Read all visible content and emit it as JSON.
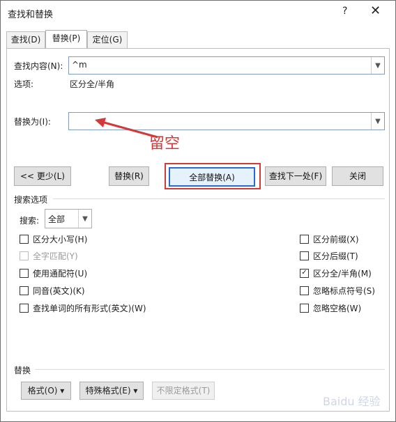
{
  "window": {
    "title": "查找和替换",
    "help": "?",
    "close": "✕"
  },
  "tabs": [
    {
      "label": "查找(D)"
    },
    {
      "label": "替换(P)"
    },
    {
      "label": "定位(G)"
    }
  ],
  "find": {
    "label": "查找内容(N):",
    "value": "^m"
  },
  "options": {
    "label": "选项:",
    "value": "区分全/半角"
  },
  "replace": {
    "label": "替换为(I):",
    "value": ""
  },
  "annotation": {
    "text": "留空"
  },
  "buttons": {
    "less": "<< 更少(L)",
    "replace": "替换(R)",
    "replace_all": "全部替换(A)",
    "find_next": "查找下一处(F)",
    "close": "关闭"
  },
  "search_options": {
    "title": "搜索选项",
    "search_label": "搜索:",
    "search_value": "全部",
    "left": [
      {
        "label": "区分大小写(H)",
        "checked": false,
        "disabled": false
      },
      {
        "label": "全字匹配(Y)",
        "checked": false,
        "disabled": true
      },
      {
        "label": "使用通配符(U)",
        "checked": false,
        "disabled": false
      },
      {
        "label": "同音(英文)(K)",
        "checked": false,
        "disabled": false
      },
      {
        "label": "查找单词的所有形式(英文)(W)",
        "checked": false,
        "disabled": false
      }
    ],
    "right": [
      {
        "label": "区分前缀(X)",
        "checked": false,
        "disabled": false
      },
      {
        "label": "区分后缀(T)",
        "checked": false,
        "disabled": false
      },
      {
        "label": "区分全/半角(M)",
        "checked": true,
        "disabled": false
      },
      {
        "label": "忽略标点符号(S)",
        "checked": false,
        "disabled": false
      },
      {
        "label": "忽略空格(W)",
        "checked": false,
        "disabled": false
      }
    ]
  },
  "replace_section": {
    "title": "替换",
    "format": "格式(O) ▾",
    "special": "特殊格式(E) ▾",
    "no_format": "不限定格式(T)"
  },
  "watermark": {
    "text": "Baidu 经验"
  }
}
